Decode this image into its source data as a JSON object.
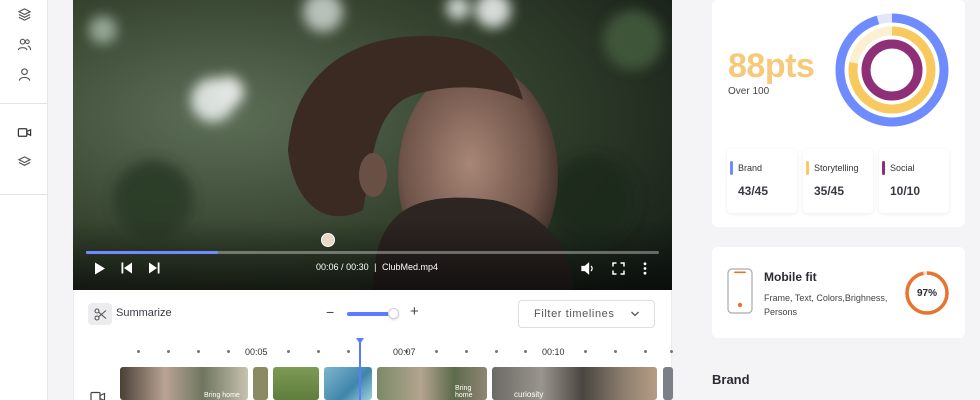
{
  "sidebar": {
    "icons": [
      "layers-icon",
      "users-icon",
      "user-icon",
      "video-camera-icon",
      "stack-icon"
    ]
  },
  "player": {
    "time_current": "00:06",
    "time_total": "00:30",
    "separator": "/",
    "divider": "|",
    "filename": "ClubMed.mp4",
    "progress": 0.23,
    "accent": "#6f8cff"
  },
  "toolbar": {
    "summarize_label": "Summarize",
    "zoom_minus": "−",
    "zoom_plus": "+",
    "zoom_level": 0.8,
    "filter_label": "Filter timelines"
  },
  "timeline": {
    "labels": [
      "00:05",
      "00:07",
      "00:10"
    ],
    "clip_texts": [
      "Bring home",
      "Bring home",
      "curiosity"
    ]
  },
  "score": {
    "value": "88pts",
    "subtitle": "Over 100",
    "metrics": [
      {
        "name": "Brand",
        "value": "43/45",
        "color": "#6f8cff"
      },
      {
        "name": "Storytelling",
        "value": "35/45",
        "color": "#f7c95e"
      },
      {
        "name": "Social",
        "value": "10/10",
        "color": "#8e2f78"
      }
    ]
  },
  "mobile_fit": {
    "title": "Mobile fit",
    "description": "Frame, Text, Colors,Brighness, Persons",
    "percent_label": "97%",
    "percent": 0.97,
    "ring_color": "#e8742f"
  },
  "brand_section": {
    "heading": "Brand"
  }
}
